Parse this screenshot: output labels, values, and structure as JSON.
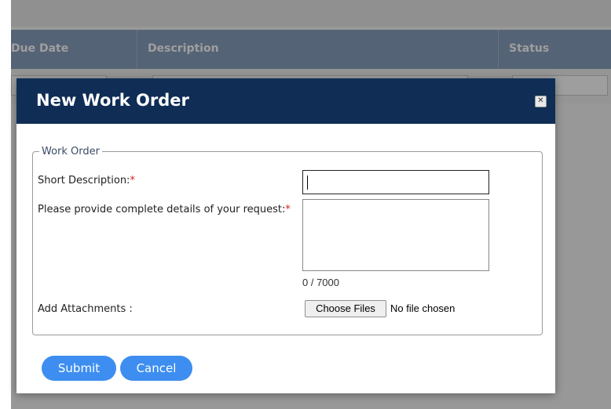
{
  "background": {
    "columns": [
      "Due Date",
      "Description",
      "Status"
    ]
  },
  "dialog": {
    "title": "New Work Order",
    "close_label": "✕",
    "fieldset_legend": "Work Order",
    "short_description": {
      "label": "Short Description:",
      "required_mark": "*",
      "value": ""
    },
    "details": {
      "label": "Please provide complete details of your request:",
      "required_mark": "*",
      "value": "",
      "counter": "0 / 7000"
    },
    "attachments": {
      "label": "Add Attachments :",
      "button_label": "Choose Files",
      "status": "No file chosen"
    },
    "buttons": {
      "submit": "Submit",
      "cancel": "Cancel"
    }
  },
  "colors": {
    "title_bar": "#0f2d55",
    "primary_button": "#3d8ef0",
    "required": "#d62020"
  }
}
